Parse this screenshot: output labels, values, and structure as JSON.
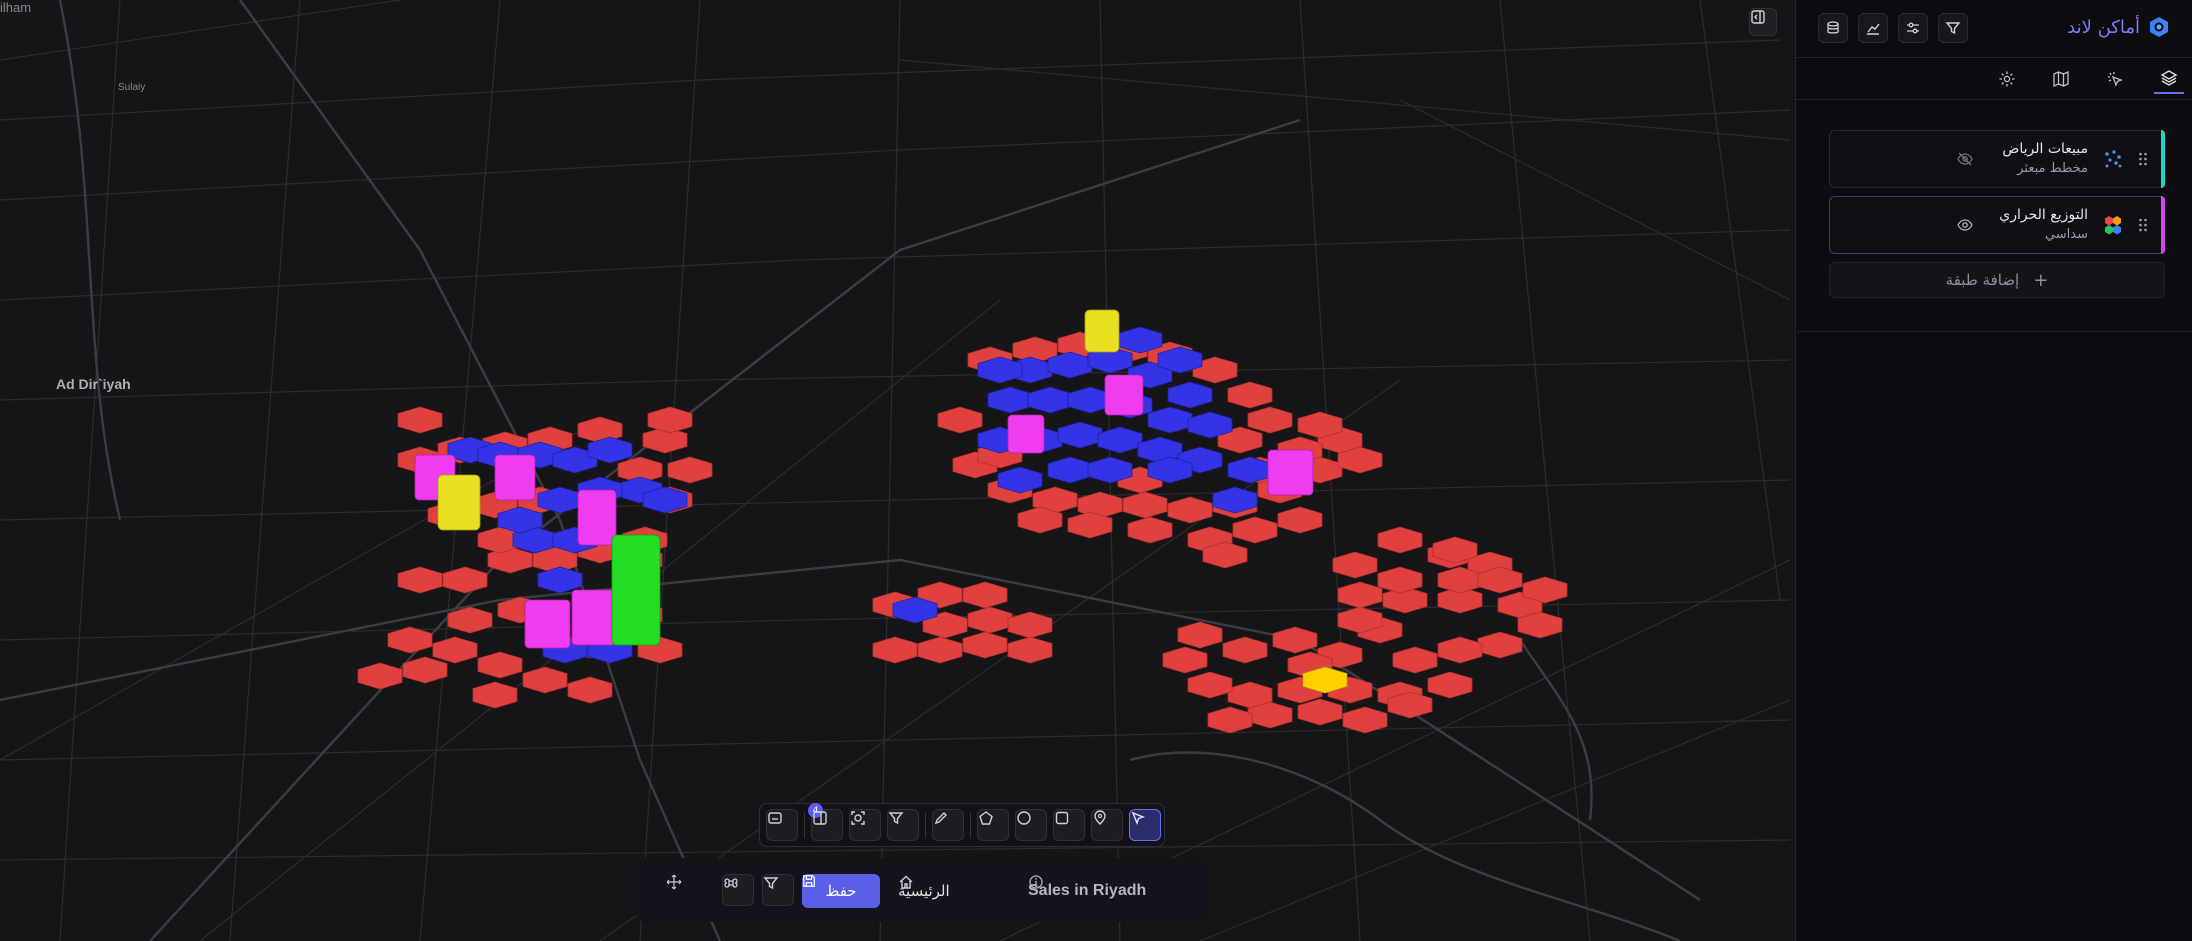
{
  "map": {
    "labels": {
      "top_left": "ilham",
      "sulaiy": "Sulaiy",
      "ad_diriyah": "Ad Dir`iyah"
    }
  },
  "toolbar": {
    "badge_count": "4",
    "tools": [
      "stickers-icon",
      "compare-panel-icon",
      "lasso-icon",
      "filter-icon",
      "pencil-icon",
      "polygon-icon",
      "circle-icon",
      "square-icon",
      "pin-icon",
      "pointer-icon"
    ]
  },
  "bottom_bar": {
    "save_label": "حفظ",
    "home_label": "الرئيسية",
    "map_title": "Sales in Riyadh"
  },
  "panel": {
    "brand": "أماكن لاند",
    "layers": [
      {
        "name": "مبيعات الرياض",
        "subtitle": "مخطط مبعثر",
        "visible": false,
        "accent": "#22d3c8"
      },
      {
        "name": "التوزيع الحراري",
        "subtitle": "سداسي",
        "visible": true,
        "accent": "#d946ef"
      }
    ],
    "add_layer_label": "إضافة طبقة"
  },
  "colors": {
    "accent": "#5b5ee6",
    "hex_red": "#e0413f",
    "hex_blue": "#3434e6",
    "hex_magenta": "#f03cf0",
    "hex_yellow": "#e8e020",
    "hex_green": "#22dd22"
  }
}
